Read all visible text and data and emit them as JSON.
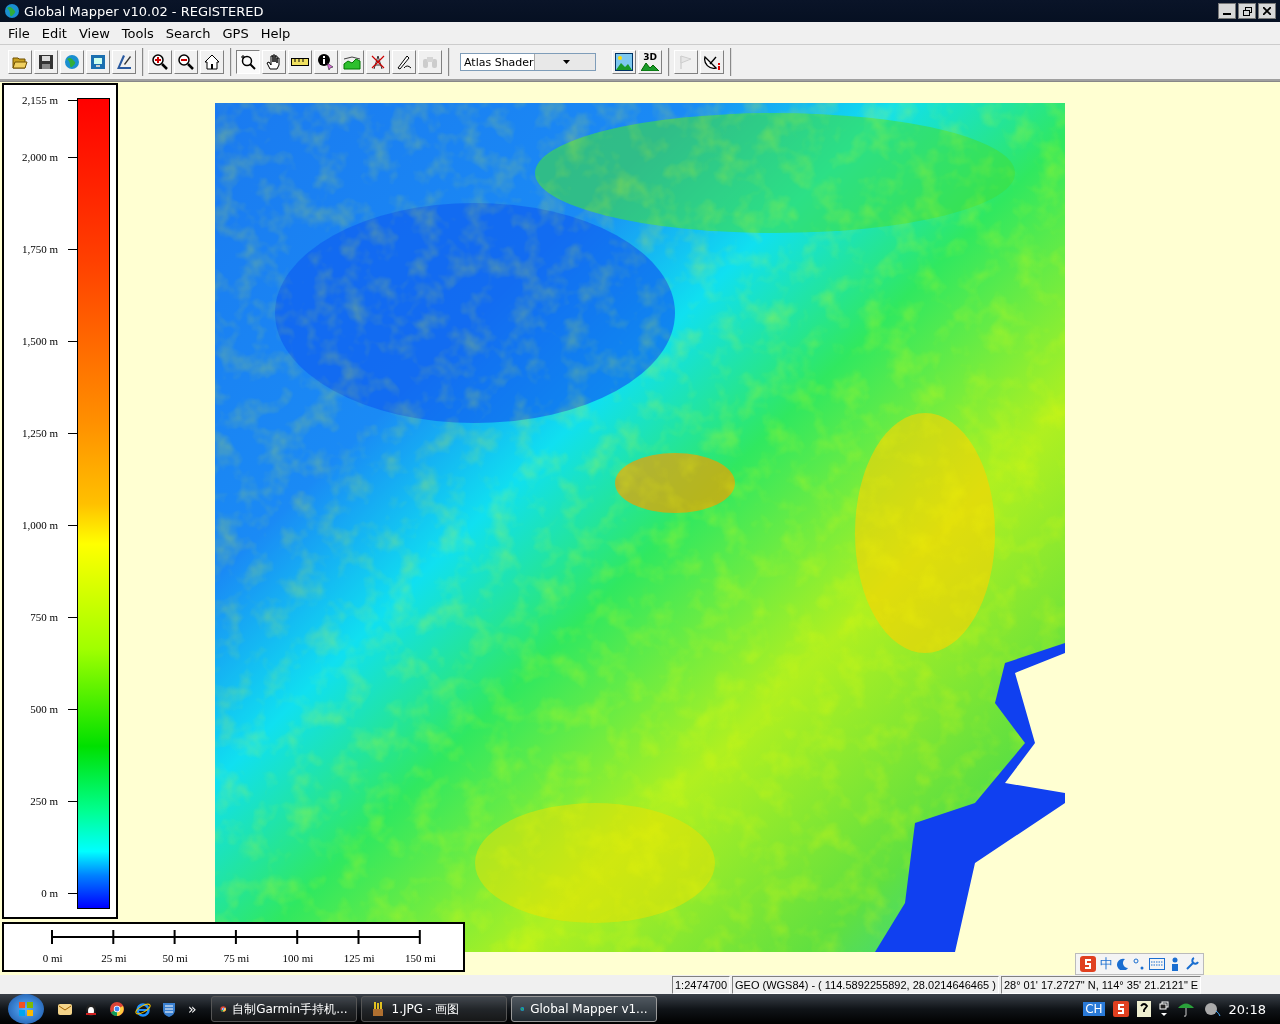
{
  "window": {
    "title": "Global Mapper v10.02 - REGISTERED"
  },
  "menu": [
    {
      "label": "File"
    },
    {
      "label": "Edit"
    },
    {
      "label": "View"
    },
    {
      "label": "Tools"
    },
    {
      "label": "Search"
    },
    {
      "label": "GPS"
    },
    {
      "label": "Help"
    }
  ],
  "toolbar": [
    {
      "kind": "buttons",
      "buttons": [
        {
          "kind": "open",
          "selected": false,
          "disabled": false
        },
        {
          "kind": "save",
          "selected": false,
          "disabled": false
        },
        {
          "kind": "globe",
          "selected": false,
          "disabled": false
        },
        {
          "kind": "export",
          "selected": false,
          "disabled": false
        },
        {
          "kind": "digitize",
          "selected": false,
          "disabled": false
        }
      ]
    },
    {
      "kind": "buttons",
      "buttons": [
        {
          "kind": "zoom-in",
          "selected": false,
          "disabled": false
        },
        {
          "kind": "zoom-out",
          "selected": false,
          "disabled": false
        },
        {
          "kind": "home",
          "selected": false,
          "disabled": false
        }
      ]
    },
    {
      "kind": "buttons",
      "buttons": [
        {
          "kind": "zoom",
          "selected": true,
          "disabled": false
        },
        {
          "kind": "pan",
          "selected": false,
          "disabled": false
        },
        {
          "kind": "ruler",
          "selected": false,
          "disabled": false
        },
        {
          "kind": "info",
          "selected": false,
          "disabled": false
        },
        {
          "kind": "profile",
          "selected": false,
          "disabled": false
        },
        {
          "kind": "tower",
          "selected": false,
          "disabled": false
        },
        {
          "kind": "pen",
          "selected": false,
          "disabled": false
        },
        {
          "kind": "binoculars",
          "selected": false,
          "disabled": true
        }
      ]
    },
    {
      "kind": "combo",
      "value": "Atlas Shader"
    },
    {
      "kind": "buttons",
      "buttons": [
        {
          "kind": "picture",
          "selected": false,
          "disabled": false
        },
        {
          "kind": "mountain",
          "label": "3D",
          "selected": false,
          "disabled": false
        }
      ]
    },
    {
      "kind": "buttons",
      "buttons": [
        {
          "kind": "flag",
          "selected": false,
          "disabled": true
        },
        {
          "kind": "satellite",
          "selected": false,
          "disabled": false
        }
      ]
    }
  ],
  "legend": {
    "labels": [
      "2,155 m",
      "2,000 m",
      "1,750 m",
      "1,500 m",
      "1,250 m",
      "1,000 m",
      "750 m",
      "500 m",
      "250 m",
      "0 m"
    ]
  },
  "scale_bar": {
    "labels": [
      "0 mi",
      "25 mi",
      "50 mi",
      "75 mi",
      "100 mi",
      "125 mi",
      "150 mi"
    ]
  },
  "ime_bar": {
    "mode": "中"
  },
  "status_bar": [
    "1:2474700",
    "GEO (WGS84) - ( 114.5892255892, 28.0214646465 )",
    "28° 01' 17.2727\" N, 114° 35' 21.2121\" E"
  ],
  "taskbar": {
    "more": "»",
    "tasks": [
      {
        "label": "自制Garmin手持机...",
        "selected": false
      },
      {
        "label": "1.JPG - 画图",
        "selected": false
      },
      {
        "label": "Global Mapper v1...",
        "selected": true
      }
    ],
    "language": "CH",
    "clock": "20:18"
  }
}
